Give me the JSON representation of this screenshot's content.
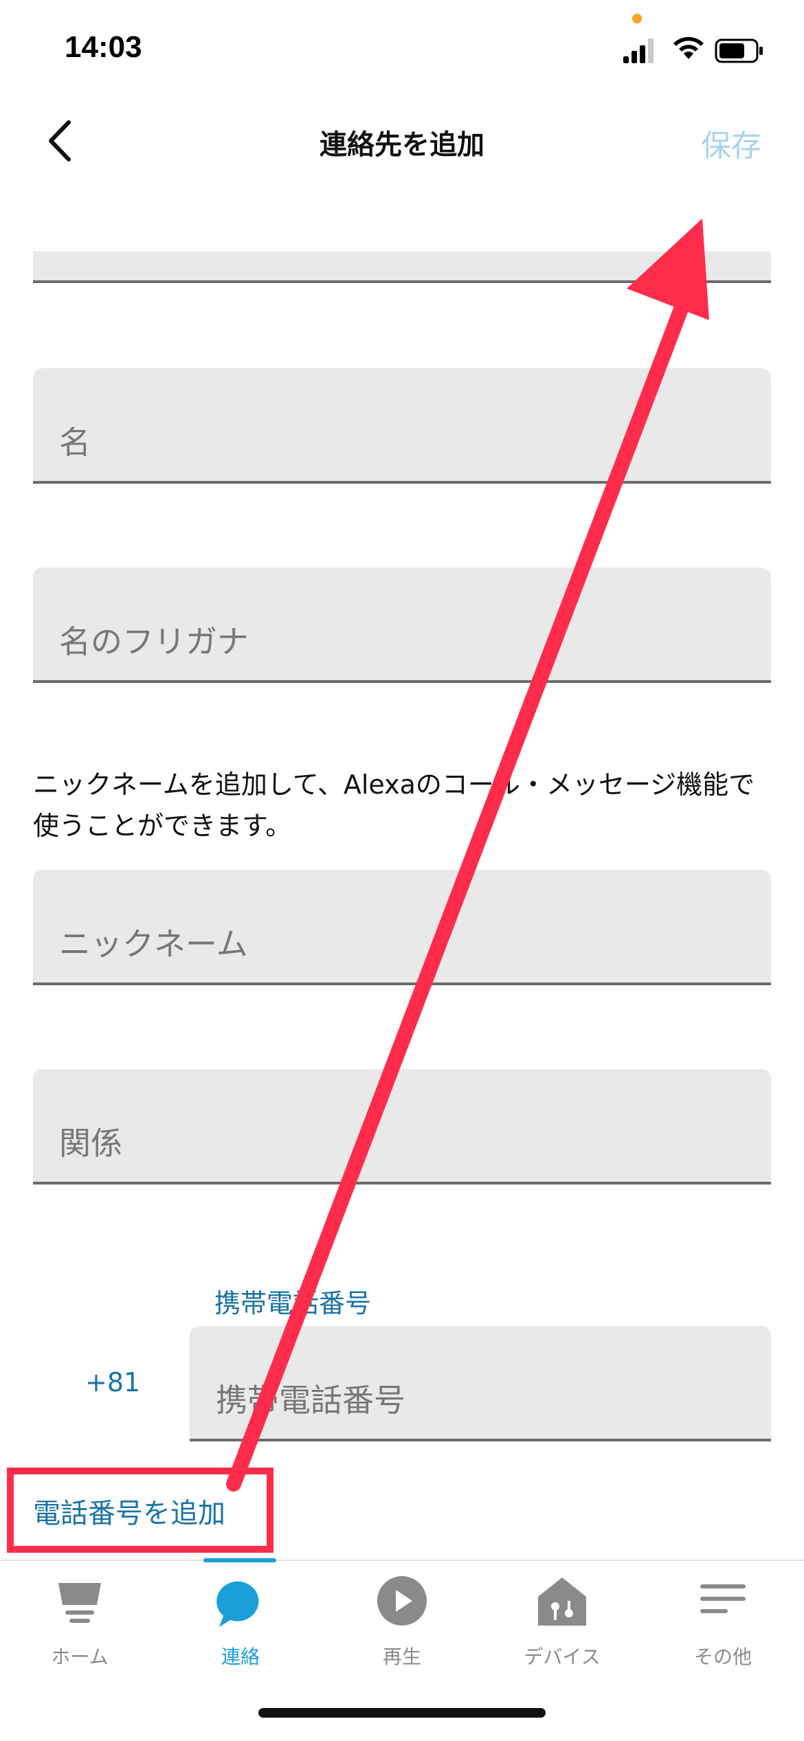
{
  "status_bar": {
    "time": "14:03"
  },
  "header": {
    "title": "連絡先を追加",
    "save_label": "保存"
  },
  "form": {
    "name_placeholder": "名",
    "name_kana_placeholder": "名のフリガナ",
    "nickname_helper": "ニックネームを追加して、Alexaのコール・メッセージ機能で使うことができます。",
    "nickname_placeholder": "ニックネーム",
    "relation_placeholder": "関係",
    "phone_label": "携帯電話番号",
    "country_code": "+81",
    "phone_placeholder": "携帯電話番号",
    "add_phone_label": "電話番号を追加"
  },
  "tabs": [
    {
      "label": "ホーム",
      "icon": "home-icon"
    },
    {
      "label": "連絡",
      "icon": "chat-bubble-icon",
      "active": true
    },
    {
      "label": "再生",
      "icon": "play-icon"
    },
    {
      "label": "デバイス",
      "icon": "devices-icon"
    },
    {
      "label": "その他",
      "icon": "menu-icon"
    }
  ],
  "colors": {
    "accent": "#1a9fd9",
    "link": "#1a73a6",
    "annotation": "#ff2d4b"
  }
}
